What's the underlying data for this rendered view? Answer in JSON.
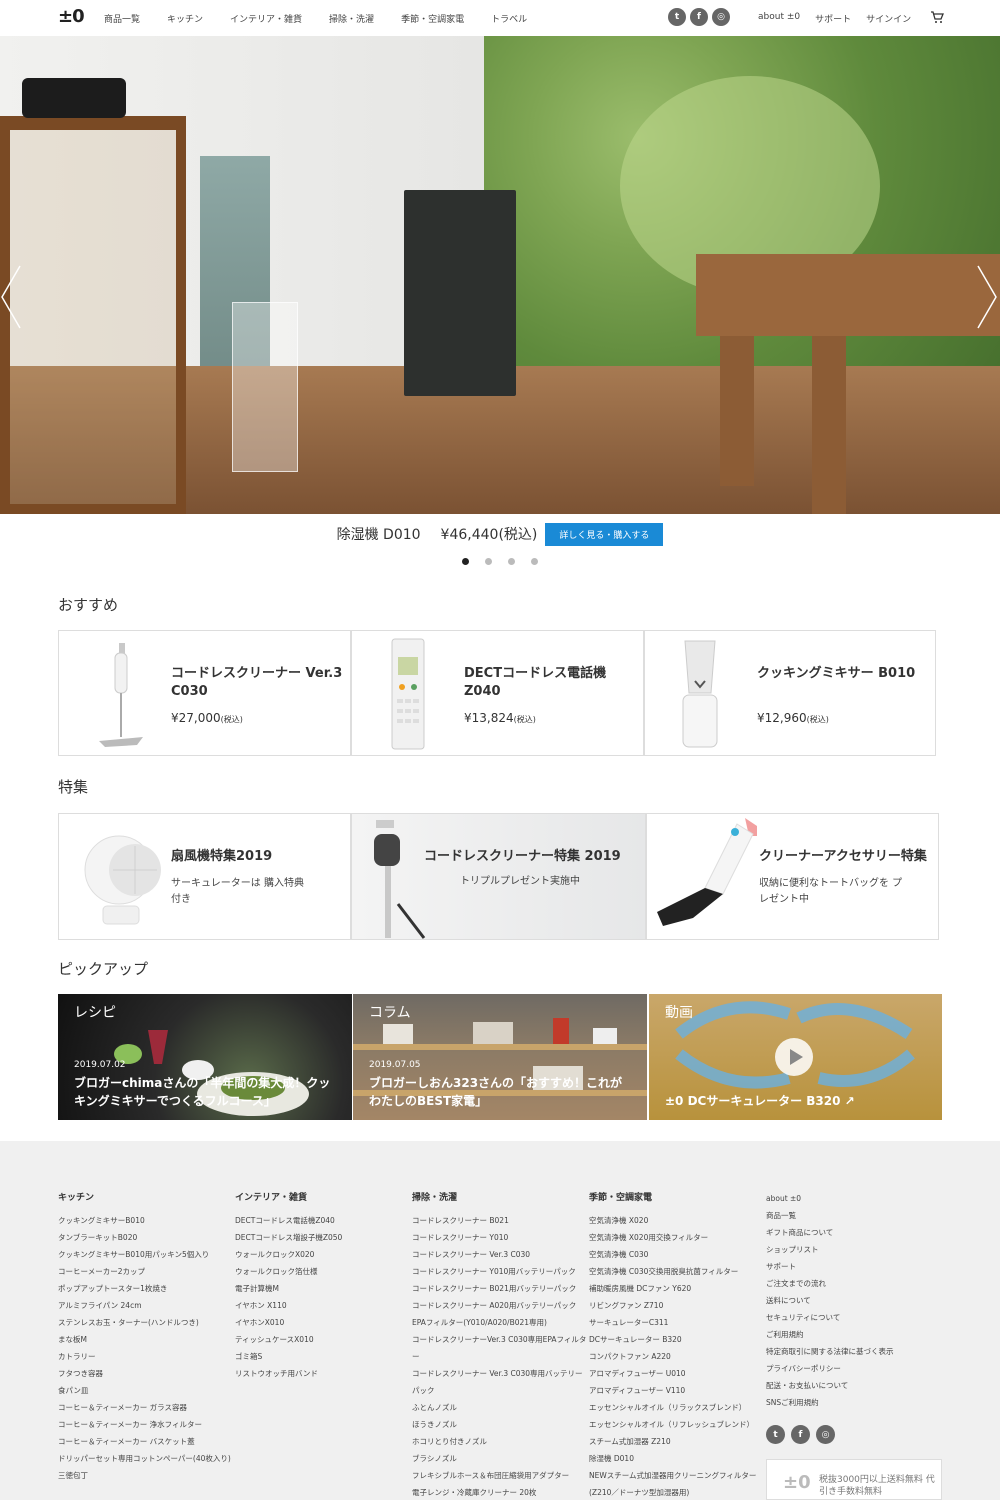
{
  "header": {
    "logo": "±0",
    "nav": [
      "商品一覧",
      "キッチン",
      "インテリア・雑貨",
      "掃除・洗濯",
      "季節・空調家電",
      "トラベル"
    ],
    "social": [
      "twitter-icon",
      "facebook-icon",
      "instagram-icon"
    ],
    "right_nav": [
      "about ±0",
      "サポート",
      "サインイン"
    ]
  },
  "hero": {
    "product_name": "除湿機 D010",
    "price": "¥46,440(税込)",
    "button": "詳しく見る・購入する",
    "slides": 4,
    "active_slide": 1
  },
  "recommend": {
    "heading": "おすすめ",
    "items": [
      {
        "title": "コードレスクリーナー Ver.3 C030",
        "price": "¥27,000",
        "tax": "(税込)"
      },
      {
        "title": "DECTコードレス電話機 Z040",
        "price": "¥13,824",
        "tax": "(税込)"
      },
      {
        "title": "クッキングミキサー B010",
        "price": "¥12,960",
        "tax": "(税込)"
      }
    ]
  },
  "features": {
    "heading": "特集",
    "items": [
      {
        "title": "扇風機特集2019",
        "sub": "サーキュレーターは 購入特典付き"
      },
      {
        "title": "コードレスクリーナー特集 2019",
        "sub": "トリプルプレゼント実施中"
      },
      {
        "title": "クリーナーアクセサリー特集",
        "sub": "収納に便利なトートバッグを プレゼント中"
      }
    ]
  },
  "pickup": {
    "heading": "ピックアップ",
    "items": [
      {
        "label": "レシピ",
        "date": "2019.07.02",
        "title": "ブロガーchimaさんの「半年間の集大成！クッキングミキサーでつくるフルコース」"
      },
      {
        "label": "コラム",
        "date": "2019.07.05",
        "title": "ブロガーしおん323さんの「おすすめ！これがわたしのBEST家電」"
      },
      {
        "label": "動画",
        "date": "",
        "title": "±0 DCサーキュレーター B320"
      }
    ]
  },
  "footer": {
    "columns": [
      {
        "heading": "キッチン",
        "items": [
          "クッキングミキサーB010",
          "タンブラーキットB020",
          "クッキングミキサーB010用パッキン5個入り",
          "コーヒーメーカー2カップ",
          "ポップアップトースター1枚焼き",
          "アルミフライパン 24cm",
          "ステンレスお玉・ターナー(ハンドルつき)",
          "まな板M",
          "カトラリー",
          "フタつき容器",
          "食パン皿",
          "コーヒー＆ティーメーカー ガラス容器",
          "コーヒー＆ティーメーカー 浄水フィルター",
          "コーヒー＆ティーメーカー バスケット蓋",
          "ドリッパーセット専用コットンペーパー(40枚入り)",
          "三徳包丁"
        ]
      },
      {
        "heading": "インテリア・雑貨",
        "items": [
          "DECTコードレス電話機Z040",
          "DECTコードレス増設子機Z050",
          "ウォールクロックX020",
          "ウォールクロック箔仕様",
          "電子計算機M",
          "イヤホン X110",
          "イヤホンX010",
          "ティッシュケースX010",
          "ゴミ箱S",
          "リストウオッチ用バンド"
        ]
      },
      {
        "heading": "掃除・洗濯",
        "items": [
          "コードレスクリーナー B021",
          "コードレスクリーナー Y010",
          "コードレスクリーナー Ver.3 C030",
          "コードレスクリーナー Y010用バッテリーパック",
          "コードレスクリーナー B021用バッテリーパック",
          "コードレスクリーナー A020用バッテリーパック",
          "EPAフィルター(Y010/A020/B021専用)",
          "コードレスクリーナーVer.3 C030専用EPAフィルター",
          "コードレスクリーナー Ver.3 C030専用バッテリーパック",
          "ふとんノズル",
          "ほうきノズル",
          "ホコリとり付きノズル",
          "ブラシノズル",
          "フレキシブルホース＆布団圧縮袋用アダプター",
          "電子レンジ・冷蔵庫クリーナー 20枚"
        ]
      },
      {
        "heading": "季節・空調家電",
        "items": [
          "空気清浄機 X020",
          "空気清浄機 X020用交換フィルター",
          "空気清浄機 C030",
          "空気清浄機 C030交換用脱臭抗菌フィルター",
          "補助暖房風機 DCファン Y620",
          "リビングファン Z710",
          "サーキュレーターC311",
          "DCサーキュレーター B320",
          "コンパクトファン A220",
          "アロマディフューザー U010",
          "アロマディフューザー V110",
          "エッセンシャルオイル（リラックスブレンド）",
          "エッセンシャルオイル（リフレッシュブレンド）",
          "スチーム式加湿器 Z210",
          "除湿機 D010",
          "NEWスチーム式加湿器用クリーニングフィルター(Z210／ドーナツ型加湿器用)"
        ]
      },
      {
        "heading": "",
        "items": [
          "about ±0",
          "商品一覧",
          "ギフト商品について",
          "ショップリスト",
          "サポート",
          "ご注文までの流れ",
          "送料について",
          "セキュリティについて",
          "ご利用規約",
          "特定商取引に関する法律に基づく表示",
          "プライバシーポリシー",
          "配送・お支払いについて",
          "SNSご利用規約"
        ]
      }
    ],
    "badge_logo": "±0",
    "badge_text": "税抜3000円以上送料無料 代引き手数料無料"
  }
}
